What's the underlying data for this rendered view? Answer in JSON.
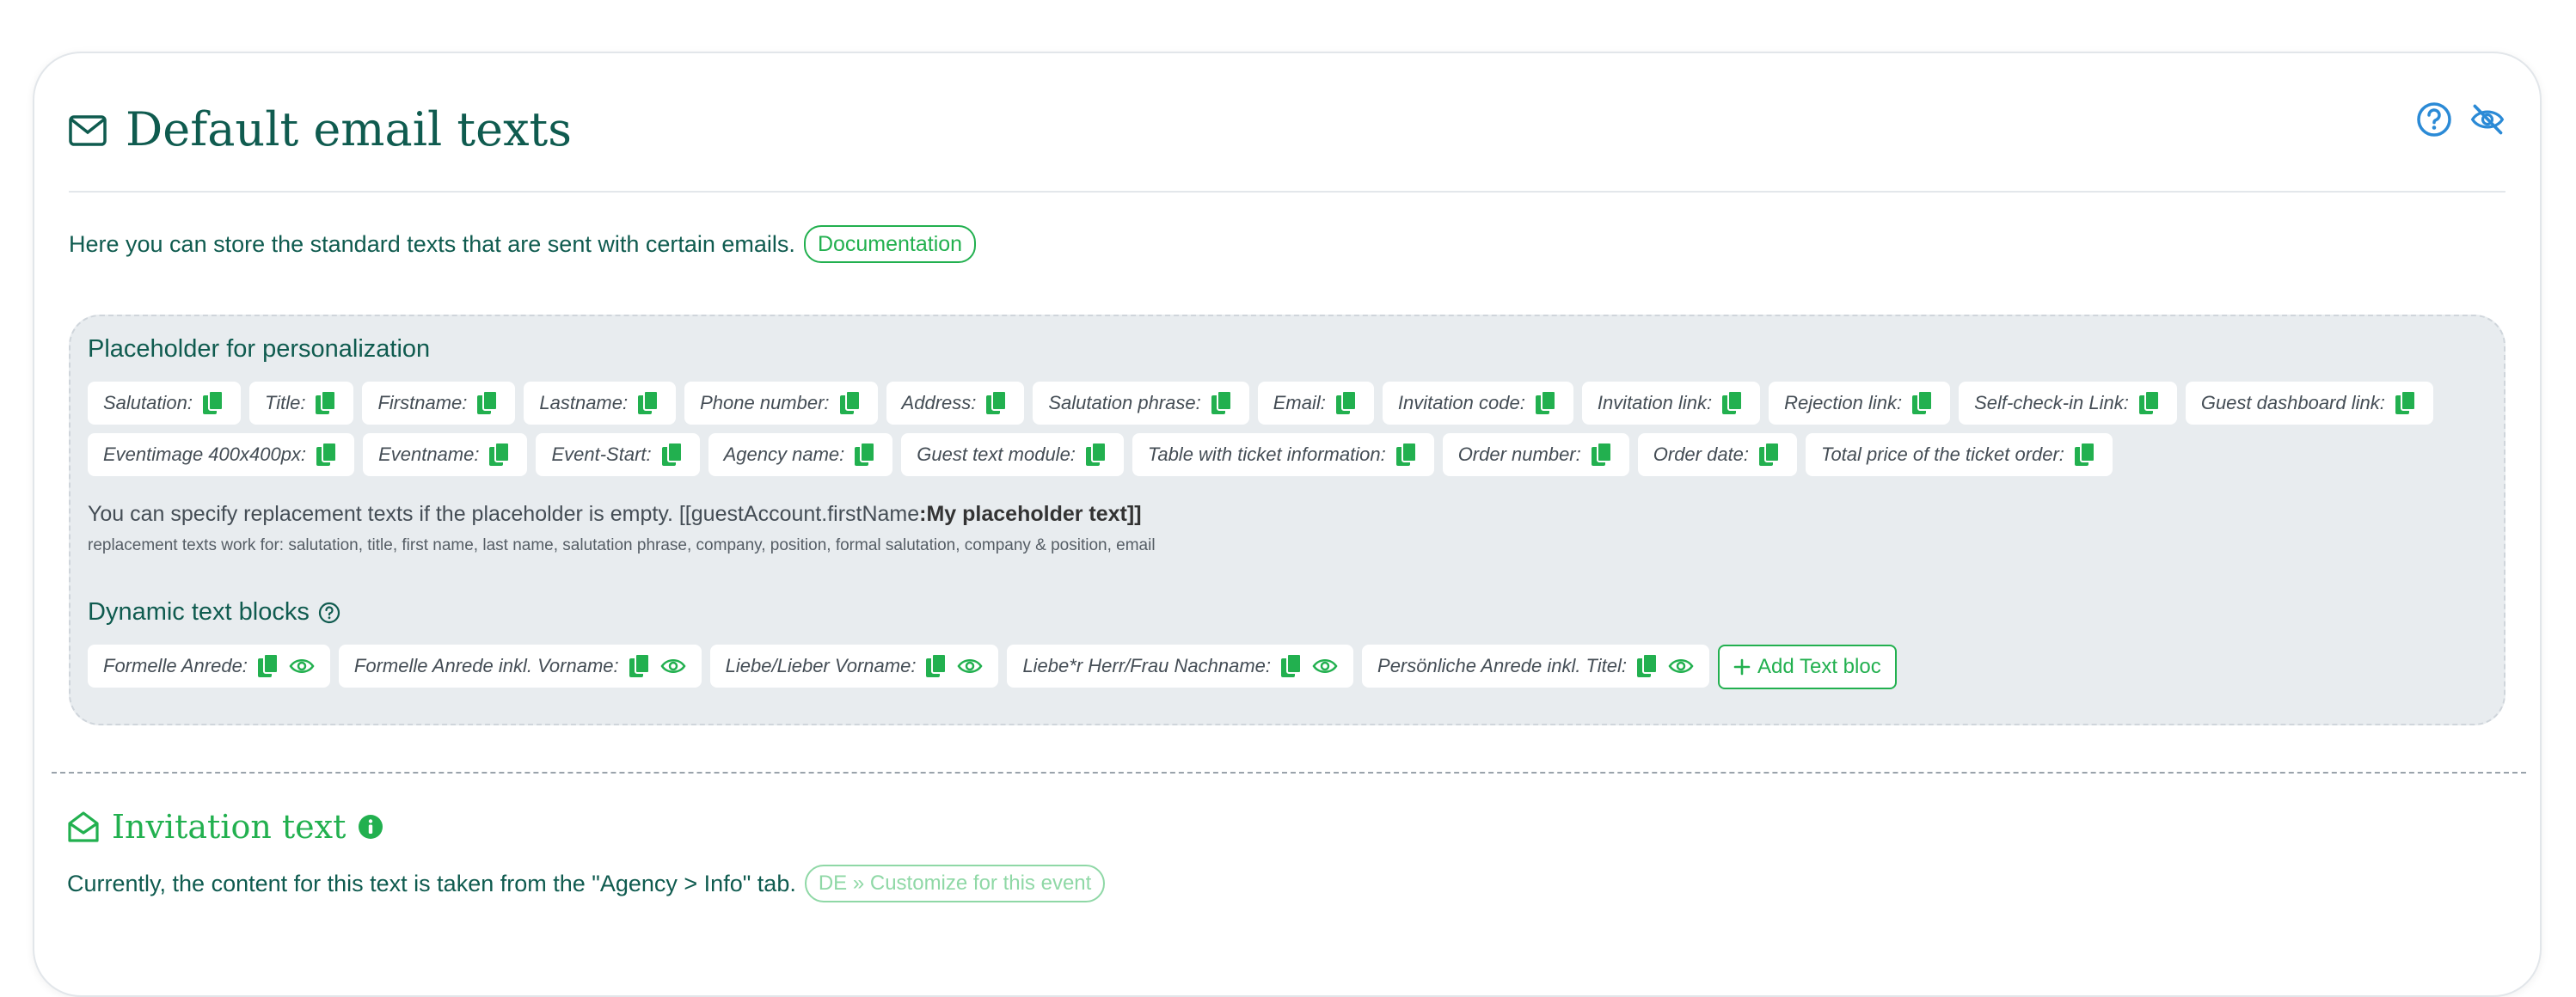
{
  "header": {
    "title": "Default email texts",
    "title_icon": "envelope-icon",
    "actions": [
      "help-circle-icon",
      "eye-slash-icon"
    ]
  },
  "intro": {
    "text": "Here you can store the standard texts that are sent with certain emails.",
    "documentation_label": "Documentation"
  },
  "placeholders": {
    "title": "Placeholder for personalization",
    "row1": [
      "Salutation:",
      "Title:",
      "Firstname:",
      "Lastname:",
      "Phone number:",
      "Address:",
      "Salutation phrase:",
      "Email:",
      "Invitation code:",
      "Invitation link:",
      "Rejection link:",
      "Self-check-in Link:",
      "Guest dashboard link:"
    ],
    "row2": [
      "Eventimage 400x400px:",
      "Eventname:",
      "Event-Start:",
      "Agency name:",
      "Guest text module:",
      "Table with ticket information:",
      "Order number:",
      "Order date:",
      "Total price of the ticket order:"
    ],
    "replacement_text": "You can specify replacement texts if the placeholder is empty. [[guestAccount.firstName",
    "replacement_bold": ":My placeholder text]]",
    "replacement_sub": "replacement texts work for: salutation, title, first name, last name, salutation phrase, company, position, formal salutation, company & position, email"
  },
  "dynamic": {
    "title": "Dynamic text blocks",
    "blocks": [
      "Formelle Anrede:",
      "Formelle Anrede inkl. Vorname:",
      "Liebe/Lieber Vorname:",
      "Liebe*r Herr/Frau Nachname:",
      "Persönliche Anrede inkl. Titel:"
    ],
    "add_label": "Add Text bloc"
  },
  "invitation": {
    "title": "Invitation text",
    "text": "Currently, the content for this text is taken from the \"Agency > Info\" tab.",
    "customize_label": "DE » Customize for this event"
  },
  "colors": {
    "primary": "#0f5b4f",
    "accent_green": "#22b04f",
    "icon_blue": "#2b8ad6",
    "panel_bg": "#e8ecef"
  }
}
